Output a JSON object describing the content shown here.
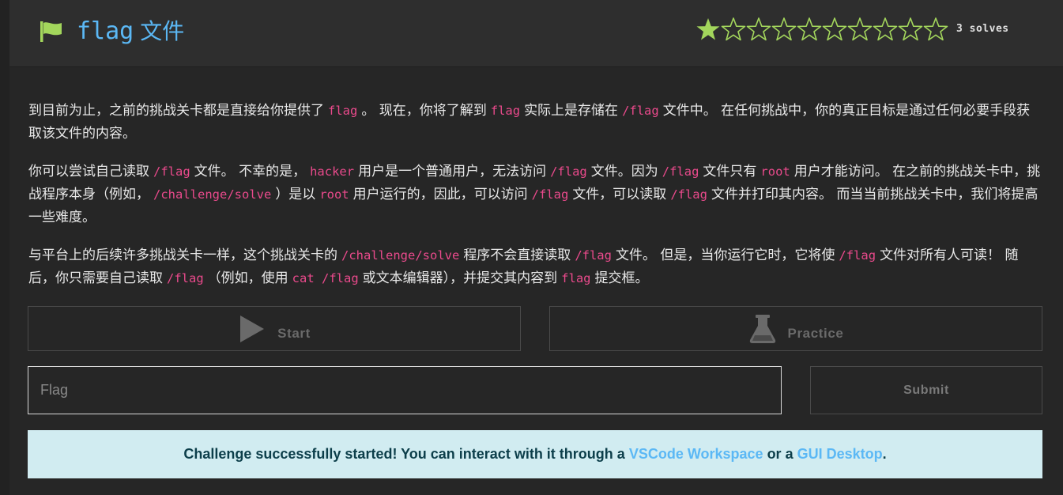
{
  "header": {
    "title_mono": "flag",
    "title_cjk": "文件",
    "rating": {
      "filled": 1,
      "total": 10
    },
    "solves": "3 solves",
    "accent_color": "#5bb8f5",
    "star_color": "#a3d65c",
    "flag_icon": "flag-icon"
  },
  "description": {
    "p1": [
      {
        "t": "text",
        "v": "到目前为止，之前的挑战关卡都是直接给你提供了"
      },
      {
        "t": "code",
        "v": "flag"
      },
      {
        "t": "text",
        "v": "。 现在，你将了解到"
      },
      {
        "t": "code",
        "v": "flag"
      },
      {
        "t": "text",
        "v": "实际上是存储在"
      },
      {
        "t": "code",
        "v": "/flag"
      },
      {
        "t": "text",
        "v": "文件中。 在任何挑战中，你的真正目标是通过任何必要手段获取该文件的内容。"
      }
    ],
    "p2": [
      {
        "t": "text",
        "v": "你可以尝试自己读取"
      },
      {
        "t": "code",
        "v": "/flag"
      },
      {
        "t": "text",
        "v": "文件。 不幸的是，"
      },
      {
        "t": "code",
        "v": "hacker"
      },
      {
        "t": "text",
        "v": "用户是一个普通用户，无法访问"
      },
      {
        "t": "code",
        "v": "/flag"
      },
      {
        "t": "text",
        "v": "文件。因为"
      },
      {
        "t": "code",
        "v": "/flag"
      },
      {
        "t": "text",
        "v": "文件只有"
      },
      {
        "t": "code",
        "v": "root"
      },
      {
        "t": "text",
        "v": "用户才能访问。 在之前的挑战关卡中，挑战程序本身（例如，"
      },
      {
        "t": "code",
        "v": "/challenge/solve"
      },
      {
        "t": "text",
        "v": "）是以"
      },
      {
        "t": "code",
        "v": "root"
      },
      {
        "t": "text",
        "v": "用户运行的，因此，可以访问"
      },
      {
        "t": "code",
        "v": "/flag"
      },
      {
        "t": "text",
        "v": "文件，可以读取"
      },
      {
        "t": "code",
        "v": "/flag"
      },
      {
        "t": "text",
        "v": "文件并打印其内容。 而当当前挑战关卡中，我们将提高一些难度。"
      }
    ],
    "p3": [
      {
        "t": "text",
        "v": "与平台上的后续许多挑战关卡一样，这个挑战关卡的"
      },
      {
        "t": "code",
        "v": "/challenge/solve"
      },
      {
        "t": "text",
        "v": "程序不会直接读取"
      },
      {
        "t": "code",
        "v": "/flag"
      },
      {
        "t": "text",
        "v": "文件。 但是，当你运行它时，它将使"
      },
      {
        "t": "code",
        "v": "/flag"
      },
      {
        "t": "text",
        "v": "文件对所有人可读！ 随后，你只需要自己读取"
      },
      {
        "t": "code",
        "v": "/flag"
      },
      {
        "t": "text",
        "v": "（例如，使用"
      },
      {
        "t": "code",
        "v": "cat /flag"
      },
      {
        "t": "text",
        "v": "或文本编辑器），并提交其内容到"
      },
      {
        "t": "code",
        "v": "flag"
      },
      {
        "t": "text",
        "v": "提交框。"
      }
    ]
  },
  "actions": {
    "start_label": "Start",
    "start_icon": "play-icon",
    "practice_label": "Practice",
    "practice_icon": "flask-icon"
  },
  "flag_form": {
    "value": "",
    "placeholder": "Flag",
    "submit_label": "Submit"
  },
  "alert": {
    "text_before": "Challenge successfully started! You can interact with it through a",
    "link1": "VSCode Workspace",
    "text_middle": "or a",
    "link2": "GUI Desktop",
    "text_after": ".",
    "background": "#d1ecf1",
    "link_color": "#5bb8f5"
  }
}
